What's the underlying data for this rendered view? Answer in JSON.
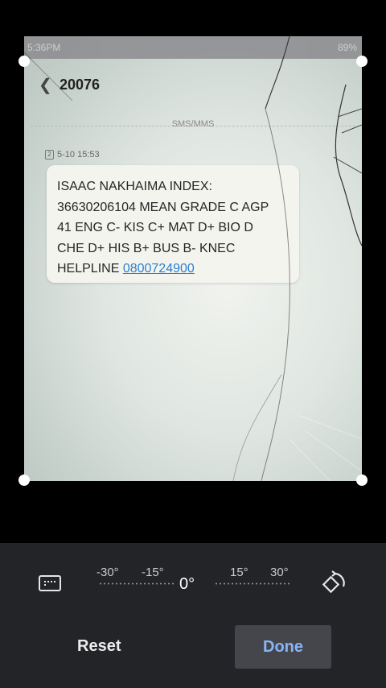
{
  "photo": {
    "status_time": "5:36PM",
    "status_right": "89%",
    "contact": "20076",
    "sms_label": "SMS/MMS",
    "timestamp": "5-10 15:53",
    "sim_badge": "2",
    "message_lines": [
      "ISAAC  NAKHAIMA  INDEX:",
      "36630206104 MEAN GRADE C AGP",
      "41 ENG C- KIS C+ MAT D+ BIO D",
      "CHE D+ HIS B+ BUS B-    KNEC",
      "HELPLINE "
    ],
    "helpline_number": "0800724900"
  },
  "editor": {
    "angle_labels": [
      "-30°",
      "-15°",
      "15°",
      "30°"
    ],
    "current_angle": "0°",
    "reset_label": "Reset",
    "done_label": "Done",
    "icons": {
      "aspect": "aspect-ratio-icon",
      "rotate": "rotate-icon",
      "back": "chevron-left-icon"
    }
  }
}
